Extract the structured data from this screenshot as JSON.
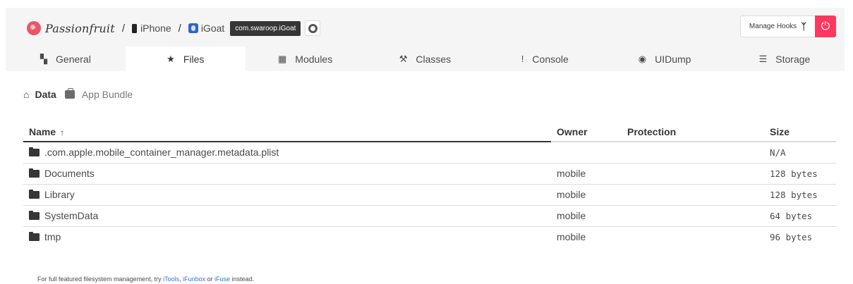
{
  "header": {
    "brand": "Passionfruit",
    "separator": "/",
    "device": "iPhone",
    "app": "iGoat",
    "bundle_id": "com.swaroop.iGoat",
    "manage_hooks": "Manage Hooks",
    "icons": {
      "logo": "passionfruit-logo",
      "device": "phone-icon",
      "app": "app-icon",
      "screenshot": "camera-shutter-icon",
      "hooks": "hook-icon",
      "power": "power-icon"
    }
  },
  "tabs": [
    {
      "label": "General",
      "icon": "grid-icon",
      "glyph": "▚"
    },
    {
      "label": "Files",
      "icon": "folder-star-icon",
      "glyph": "★"
    },
    {
      "label": "Modules",
      "icon": "modules-icon",
      "glyph": "▦"
    },
    {
      "label": "Classes",
      "icon": "gavel-icon",
      "glyph": "⚒"
    },
    {
      "label": "Console",
      "icon": "console-alert-icon",
      "glyph": "!"
    },
    {
      "label": "UIDump",
      "icon": "eye-icon",
      "glyph": "◉"
    },
    {
      "label": "Storage",
      "icon": "storage-icon",
      "glyph": "☰"
    }
  ],
  "active_tab": "Files",
  "location": {
    "home_icon": "home-icon",
    "data": "Data",
    "bundle_icon": "briefcase-icon",
    "bundle": "App Bundle"
  },
  "table": {
    "columns": {
      "name": "Name",
      "sort": "↑",
      "owner": "Owner",
      "protection": "Protection",
      "size": "Size"
    },
    "rows": [
      {
        "name": ".com.apple.mobile_container_manager.metadata.plist",
        "owner": "",
        "protection": "",
        "size": "N/A"
      },
      {
        "name": "Documents",
        "owner": "mobile",
        "protection": "",
        "size": "128 bytes"
      },
      {
        "name": "Library",
        "owner": "mobile",
        "protection": "",
        "size": "128 bytes"
      },
      {
        "name": "SystemData",
        "owner": "mobile",
        "protection": "",
        "size": "64 bytes"
      },
      {
        "name": "tmp",
        "owner": "mobile",
        "protection": "",
        "size": "96 bytes"
      }
    ]
  },
  "footer": {
    "prefix": "For full featured filesystem management, try ",
    "link1": "iTools",
    "sep1": ", ",
    "link2": "iFunbox",
    "sep2": " or ",
    "link3": "iFuse",
    "suffix": " instead."
  },
  "colors": {
    "accent_danger": "#ff3860",
    "link": "#3273dc",
    "tag_bg": "#363636",
    "topbar_bg": "#f5f5f5"
  }
}
